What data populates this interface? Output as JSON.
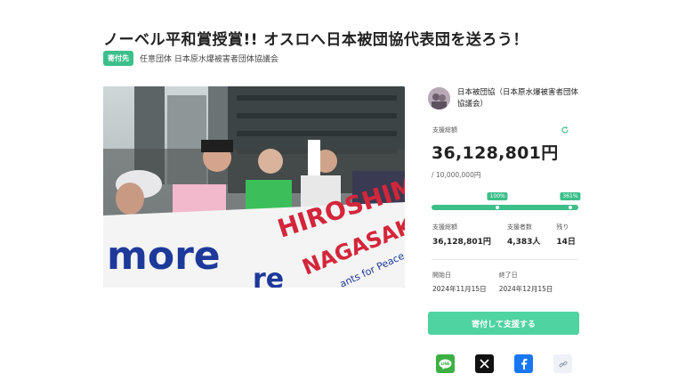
{
  "project": {
    "title": "ノーベル平和賞授賞!! オスロへ日本被団協代表団を送ろう！",
    "recipient_badge": "寄付先",
    "recipient_type": "任意団体 日本原水爆被害者団体協議会"
  },
  "hero": {
    "banner_word_1": "more",
    "banner_word_2": "HIROSHIMA",
    "banner_word_3": "NAGASAKI",
    "banner_word_4": "re",
    "banner_word_5": "ants for Peace"
  },
  "creator": {
    "name": "日本被団協（日本原水爆被害者団体協議会）"
  },
  "funding": {
    "raised_label": "支援総額",
    "raised_amount": "36,128,801円",
    "goal_text": "/ 10,000,000円",
    "progress_percent": 361,
    "marker_100": "100%",
    "marker_current": "361%"
  },
  "stats": [
    {
      "label": "支援総額",
      "value": "36,128,801円"
    },
    {
      "label": "支援者数",
      "value": "4,383人"
    },
    {
      "label": "残り",
      "value": "14日"
    }
  ],
  "dates": {
    "start_label": "開始日",
    "start_value": "2024年11月15日",
    "end_label": "終了日",
    "end_value": "2024年12月15日"
  },
  "cta": {
    "label": "寄付して支援する"
  },
  "share": {
    "line_text": "LINE"
  },
  "colors": {
    "accent": "#3cbf8a",
    "button": "#4fd3a0",
    "line": "#3cb043",
    "facebook": "#1877f2"
  },
  "icons": [
    "refresh-icon",
    "line-icon",
    "x-icon",
    "facebook-icon",
    "link-icon"
  ]
}
